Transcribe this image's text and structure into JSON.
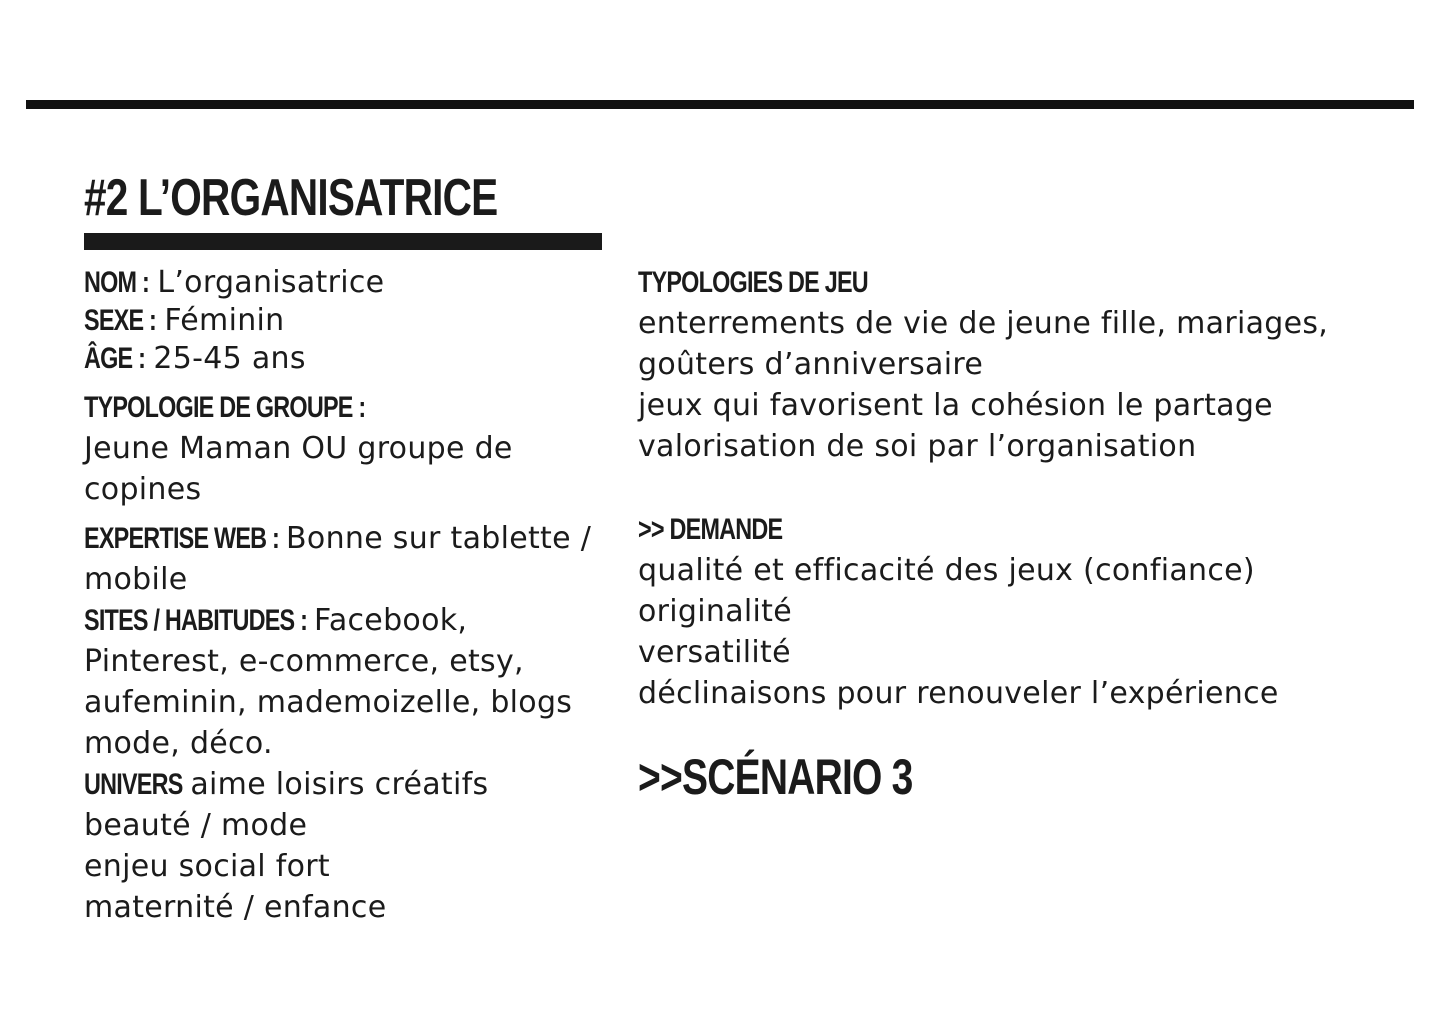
{
  "persona": {
    "title": "#2 L’ORGANISATRICE"
  },
  "identity": {
    "nom_label": "NOM :",
    "nom_value": "L’organisatrice",
    "sexe_label": "SEXE :",
    "sexe_value": "Féminin",
    "age_label": "ÂGE :",
    "age_value": "25-45 ans"
  },
  "groupe": {
    "label": "TYPOLOGIE DE GROUPE :",
    "lines": [
      "Jeune Maman OU groupe de",
      "copines"
    ]
  },
  "expertise": {
    "label": "EXPERTISE WEB :",
    "value_first": "Bonne sur tablette /",
    "value_rest": "mobile"
  },
  "sites": {
    "label": "SITES / HABITUDES :",
    "value_first": "Facebook,",
    "lines": [
      "Pinterest, e-commerce, etsy,",
      "aufeminin, mademoizelle, blogs",
      "mode, déco."
    ]
  },
  "univers": {
    "label": "UNIVERS",
    "value_first": "aime loisirs créatifs",
    "lines": [
      "beauté / mode",
      "enjeu social fort",
      "maternité / enfance"
    ]
  },
  "typologies_jeu": {
    "label": "TYPOLOGIES DE JEU",
    "lines": [
      "enterrements de vie de jeune fille, mariages,",
      "goûters d’anniversaire",
      "jeux qui favorisent la cohésion le partage",
      "valorisation de soi par l’organisation"
    ]
  },
  "demande": {
    "label": ">> DEMANDE",
    "lines": [
      "qualité et efficacité des jeux (confiance)",
      "originalité",
      "versatilité",
      "déclinaisons pour renouveler l’expérience"
    ]
  },
  "scenario": {
    "label": ">>SCÉNARIO 3"
  }
}
